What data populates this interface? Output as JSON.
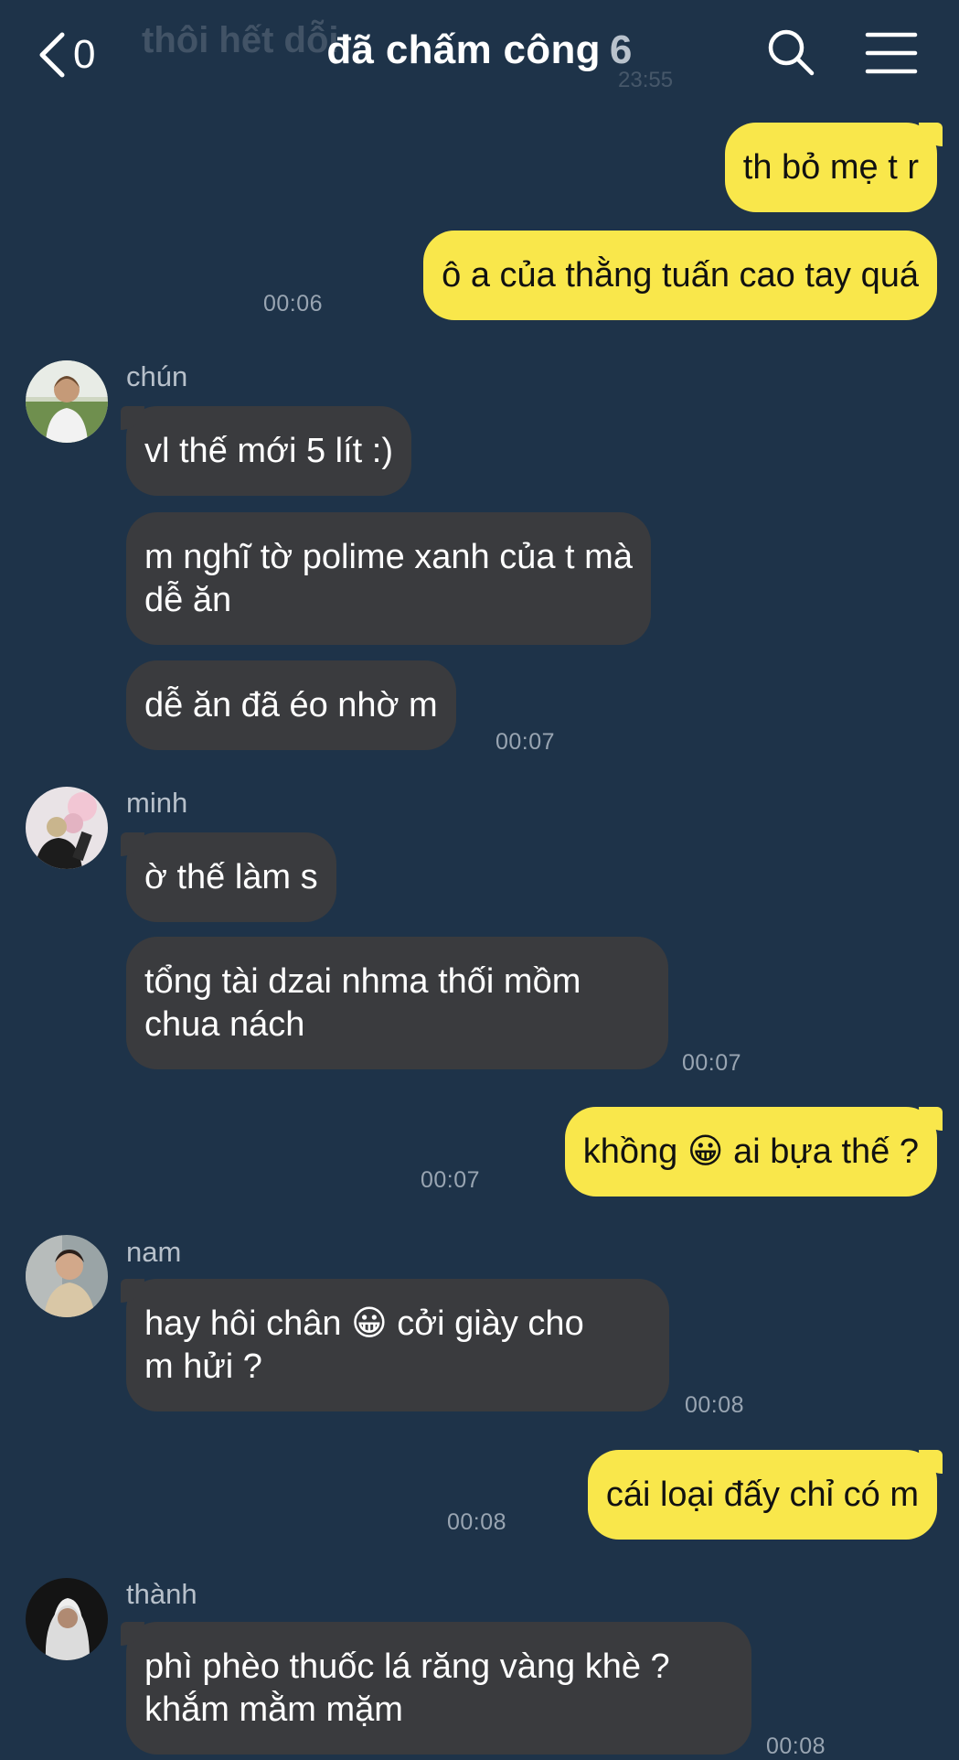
{
  "header": {
    "back_count": "0",
    "title": "đã chấm công",
    "member_count": "6",
    "ghost_preview": "thôi hết dỗi",
    "ghost_time": "23:55"
  },
  "messages": [
    {
      "side": "me",
      "text": "th bỏ mẹ t r"
    },
    {
      "side": "me",
      "text": "ô a của thằng tuấn cao tay quá",
      "time": "00:06"
    },
    {
      "side": "other",
      "sender": "chún",
      "text": "vl thế mới 5 lít :)"
    },
    {
      "side": "other",
      "text": "m nghĩ tờ polime xanh của t mà\ndễ ăn"
    },
    {
      "side": "other",
      "text": "dễ ăn đã éo nhờ m",
      "time": "00:07"
    },
    {
      "side": "other",
      "sender": "minh",
      "text": "ờ thế làm s"
    },
    {
      "side": "other",
      "text": "tổng tài dzai nhma thối mồm\nchua nách",
      "time": "00:07"
    },
    {
      "side": "me",
      "text_before": "khồng",
      "emoji": "😀",
      "text_after": "ai bựa thế ?",
      "time": "00:07"
    },
    {
      "side": "other",
      "sender": "nam",
      "text_before": "hay hôi chân",
      "emoji": "😀",
      "text_after": "cởi giày cho\nm hửi ?",
      "time": "00:08"
    },
    {
      "side": "me",
      "text": "cái loại đấy chỉ có m",
      "time": "00:08"
    },
    {
      "side": "other",
      "sender": "thành",
      "text": "phì phèo thuốc lá răng vàng khè ?\nkhắm mằm mặm",
      "time": "00:08"
    }
  ],
  "icons": {
    "back": "chevron-left-icon",
    "search": "search-icon",
    "menu": "hamburger-menu-icon"
  },
  "colors": {
    "background": "#1e3349",
    "my_bubble": "#f9e74b",
    "other_bubble": "#3a3b3e",
    "timestamp": "#99a5b2",
    "sender_name": "#b7c0ca"
  }
}
